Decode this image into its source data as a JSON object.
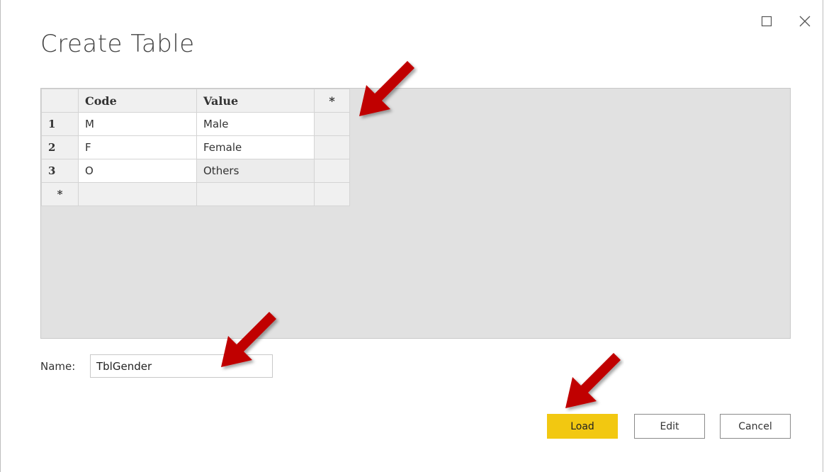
{
  "window": {
    "title": "Create Table",
    "maximize_icon": "maximize-icon",
    "close_icon": "close-icon"
  },
  "table": {
    "header_star": "*",
    "columns": [
      "Code",
      "Value"
    ],
    "rows": [
      {
        "num": "1",
        "code": "M",
        "value": "Male"
      },
      {
        "num": "2",
        "code": "F",
        "value": "Female"
      },
      {
        "num": "3",
        "code": "O",
        "value": "Others"
      }
    ],
    "new_row_marker": "*"
  },
  "name_field": {
    "label": "Name:",
    "value": "TblGender"
  },
  "buttons": {
    "load": "Load",
    "edit": "Edit",
    "cancel": "Cancel"
  },
  "colors": {
    "load_button": "#f2c811",
    "annotation_arrow": "#c00000",
    "grid_background": "#e1e1e1"
  }
}
